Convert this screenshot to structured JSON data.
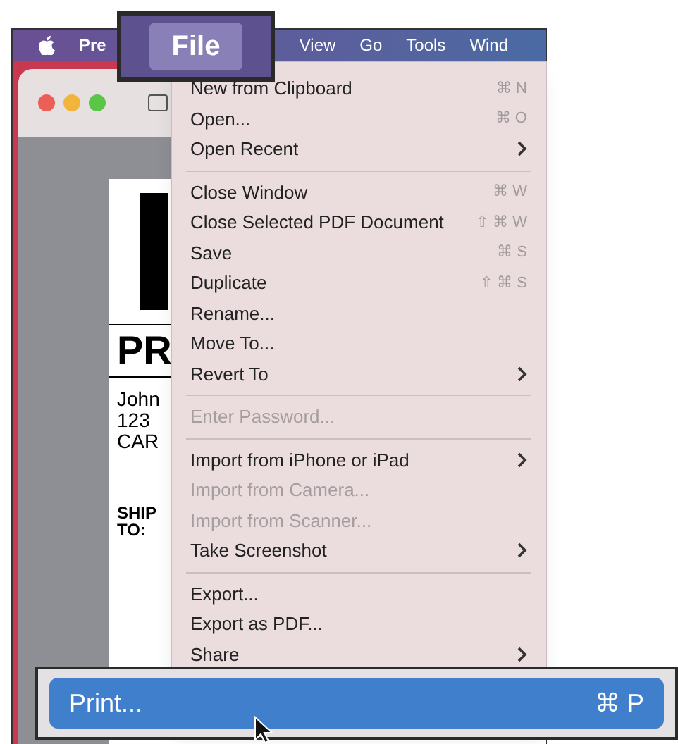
{
  "menu_bar": {
    "items": [
      {
        "label": "Pre",
        "selected": false
      },
      {
        "label": "View",
        "selected": false
      },
      {
        "label": "Go",
        "selected": false
      },
      {
        "label": "Tools",
        "selected": false
      },
      {
        "label": "Wind",
        "selected": false
      }
    ]
  },
  "callout_menu": {
    "label": "File",
    "selected": true
  },
  "document": {
    "lines": [
      {
        "kind": "heading",
        "text": "PR"
      },
      {
        "kind": "address",
        "text": "John"
      },
      {
        "kind": "address",
        "text": "123"
      },
      {
        "kind": "address",
        "text": "CAR"
      },
      {
        "kind": "label",
        "text": "SHIP"
      },
      {
        "kind": "label",
        "text": "TO:"
      }
    ]
  },
  "file_menu": {
    "items": [
      {
        "kind": "item",
        "label": "New from Clipboard",
        "shortcut": "⌘ N",
        "submenu": false,
        "disabled": false
      },
      {
        "kind": "item",
        "label": "Open...",
        "shortcut": "⌘ O",
        "submenu": false,
        "disabled": false
      },
      {
        "kind": "item",
        "label": "Open Recent",
        "submenu": true,
        "disabled": false
      },
      {
        "kind": "separator"
      },
      {
        "kind": "item",
        "label": "Close Window",
        "shortcut": "⌘ W",
        "submenu": false,
        "disabled": false
      },
      {
        "kind": "item",
        "label": "Close Selected PDF Document",
        "shortcut": "⇧ ⌘ W",
        "submenu": false,
        "disabled": false
      },
      {
        "kind": "item",
        "label": "Save",
        "shortcut": "⌘ S",
        "submenu": false,
        "disabled": false
      },
      {
        "kind": "item",
        "label": "Duplicate",
        "shortcut": "⇧ ⌘ S",
        "submenu": false,
        "disabled": false
      },
      {
        "kind": "item",
        "label": "Rename...",
        "submenu": false,
        "disabled": false
      },
      {
        "kind": "item",
        "label": "Move To...",
        "submenu": false,
        "disabled": false
      },
      {
        "kind": "item",
        "label": "Revert To",
        "submenu": true,
        "disabled": false
      },
      {
        "kind": "separator"
      },
      {
        "kind": "item",
        "label": "Enter Password...",
        "submenu": false,
        "disabled": true
      },
      {
        "kind": "separator"
      },
      {
        "kind": "item",
        "label": "Import from iPhone or iPad",
        "submenu": true,
        "disabled": false
      },
      {
        "kind": "item",
        "label": "Import from Camera...",
        "submenu": false,
        "disabled": true
      },
      {
        "kind": "item",
        "label": "Import from Scanner...",
        "submenu": false,
        "disabled": true
      },
      {
        "kind": "item",
        "label": "Take Screenshot",
        "submenu": true,
        "disabled": false
      },
      {
        "kind": "separator"
      },
      {
        "kind": "item",
        "label": "Export...",
        "submenu": false,
        "disabled": false
      },
      {
        "kind": "item",
        "label": "Export as PDF...",
        "submenu": false,
        "disabled": false
      },
      {
        "kind": "item",
        "label": "Share",
        "submenu": true,
        "disabled": false
      }
    ]
  },
  "callout_item": {
    "label": "Print...",
    "shortcut": "⌘ P",
    "selected": true
  }
}
